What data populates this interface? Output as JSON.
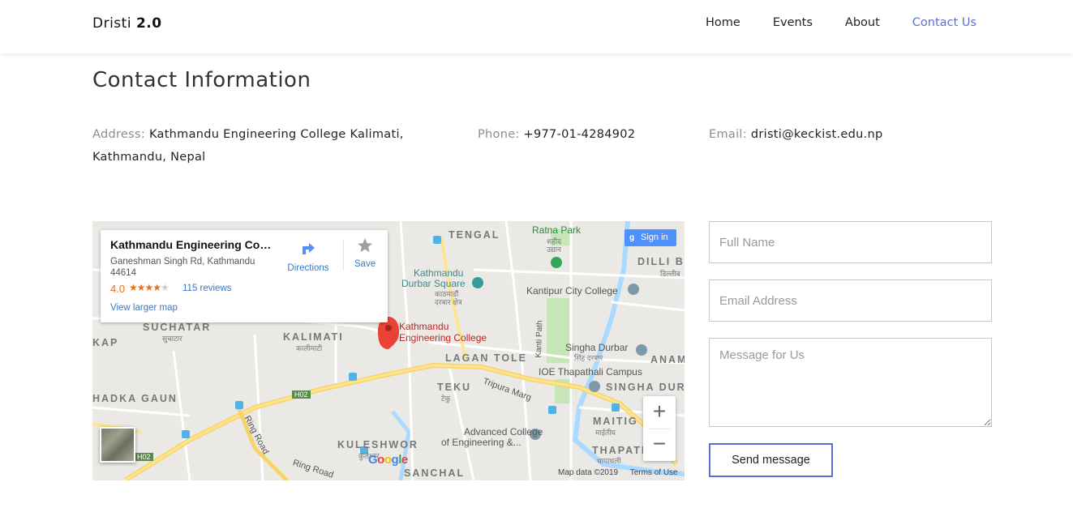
{
  "brand": {
    "name": "Dristi",
    "version": "2.0"
  },
  "nav": {
    "items": [
      "Home",
      "Events",
      "About",
      "Contact Us"
    ],
    "active": "Contact Us",
    "active_color": "#5a6fd6"
  },
  "contact": {
    "title": "Contact Information",
    "address_label": "Address:",
    "address_value": "Kathmandu Engineering College Kalimati, Kathmandu, Nepal",
    "phone_label": "Phone:",
    "phone_value": "+977-01-4284902",
    "email_label": "Email:",
    "email_value": "dristi@keckist.edu.np"
  },
  "map": {
    "card": {
      "title": "Kathmandu Engineering Colle...",
      "address": "Ganeshman Singh Rd, Kathmandu 44614",
      "rating": "4.0",
      "stars": "★★★★",
      "star_empty": "★",
      "reviews": "115 reviews",
      "larger_map": "View larger map",
      "directions": "Directions",
      "save": "Save"
    },
    "signin": "Sign in",
    "signin_glyph": "g",
    "marker_label_1": "Kathmandu",
    "marker_label_2": "Engineering College",
    "areas": {
      "tengal": "TENGAL",
      "dilli": "DILLI BA",
      "dilli_dev": "डिल्लीब",
      "suchatar": "SUCHATAR",
      "suchatar_dev": "सुचाटार",
      "kap": "KAP",
      "kalimati": "KALIMATI",
      "kalimati_dev": "कालीमाटी",
      "lagan": "LAGAN TOLE",
      "anam": "ANAM",
      "teku": "TEKU",
      "teku_dev": "टेकु",
      "singha": "SINGHA DURB",
      "hadka": "HADKA GAUN",
      "maitig": "MAITIG",
      "maitig_dev": "माईतीघ",
      "kuleshwor": "KULESHWOR",
      "kuleshwor_dev": "कुलेश्वर",
      "thapath": "THAPATH",
      "thapath_dev": "थापाथली",
      "sanchal": "SANCHAL"
    },
    "pois": {
      "ratna_park": "Ratna Park",
      "ratna_dev_1": "शहीद",
      "ratna_dev_2": "उद्यान",
      "durbar_1": "Kathmandu",
      "durbar_2": "Durbar Square",
      "durbar_dev_1": "काठमाडौं",
      "durbar_dev_2": "दरबार क्षेत्र",
      "kantipur": "Kantipur City College",
      "singha_durbar": "Singha Durbar",
      "singha_dev": "सिंह दरबार",
      "ioe": "IOE Thapathali Campus",
      "advanced_1": "Advanced College",
      "advanced_2": "of Engineering &..."
    },
    "roads": {
      "tripura": "Tripura Marg",
      "ring1": "Ring Road",
      "ring2": "Ring Road",
      "kanti": "Kanti Path",
      "h02a": "H02",
      "h02b": "H02"
    },
    "zoom_in": "+",
    "zoom_out": "−",
    "attribution_data": "Map data ©2019",
    "attribution_terms": "Terms of Use",
    "google": "Google"
  },
  "form": {
    "name_placeholder": "Full Name",
    "email_placeholder": "Email Address",
    "message_placeholder": "Message for Us",
    "submit": "Send message"
  }
}
